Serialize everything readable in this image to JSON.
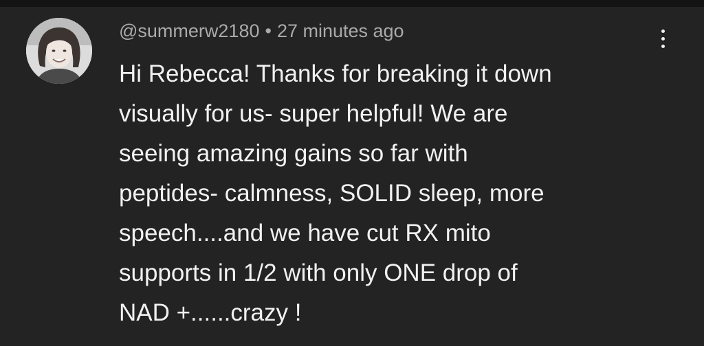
{
  "comment": {
    "author": "@summerw2180",
    "separator": "•",
    "timestamp": "27 minutes ago",
    "menu_icon": "more-vertical-icon",
    "avatar_icon": "user-avatar-photo",
    "text_lines": [
      "Hi Rebecca! Thanks for breaking it down",
      "visually for us- super helpful! We are",
      "seeing amazing gains so far with",
      "peptides- calmness, SOLID sleep, more",
      "speech....and we have cut RX mito",
      "supports in 1/2 with only ONE drop of",
      "NAD +......crazy !"
    ]
  },
  "colors": {
    "background": "#232323",
    "top_strip": "#141414",
    "meta_text": "#aaaaaa",
    "body_text": "#f1f1f1"
  }
}
